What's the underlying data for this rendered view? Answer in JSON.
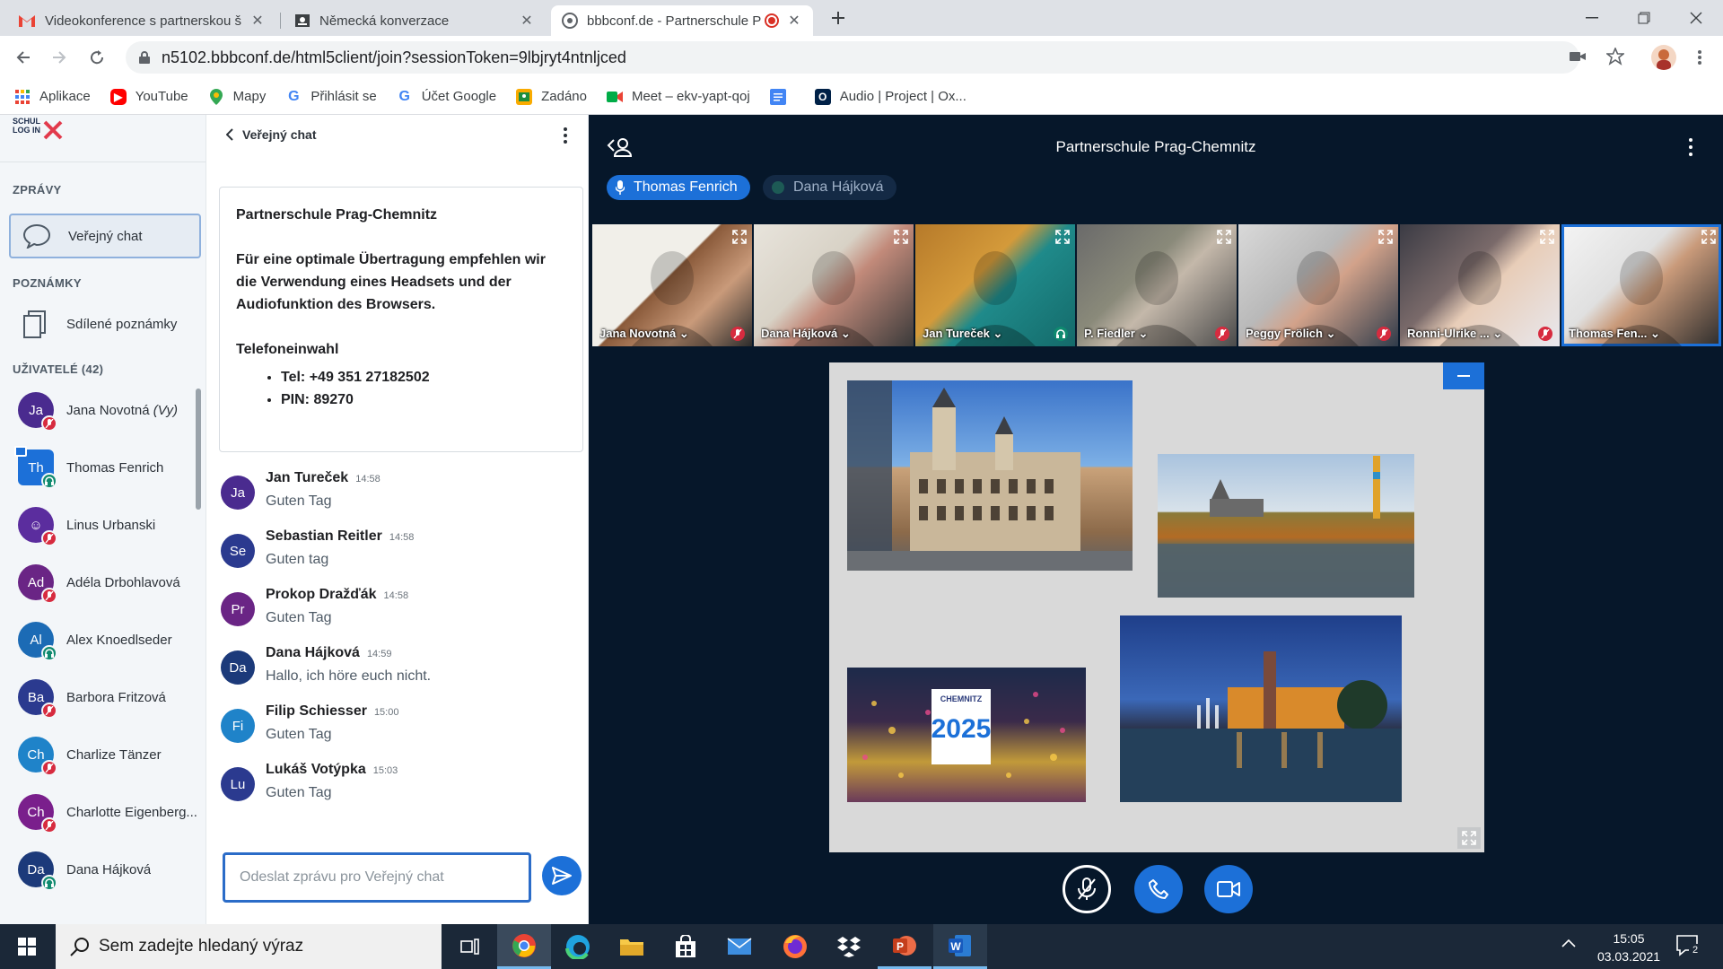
{
  "browser": {
    "tabs": [
      {
        "title": "Videokonference s partnerskou š",
        "favicon": "gmail-icon"
      },
      {
        "title": "Německá konverzace",
        "favicon": "classroom-icon"
      },
      {
        "title": "bbbconf.de - Partnerschule P",
        "favicon": "bbb-icon"
      }
    ],
    "url": "n5102.bbbconf.de/html5client/join?sessionToken=9lbjryt4ntnljced",
    "bookmarks": [
      "Aplikace",
      "YouTube",
      "Mapy",
      "Přihlásit se",
      "Účet Google",
      "Zadáno",
      "Meet – ekv-yapt-qoj",
      "",
      "Audio | Project | Ox..."
    ]
  },
  "sidebar": {
    "logo": "SCHUL LOG IN",
    "messages_title": "ZPRÁVY",
    "public_chat": "Veřejný chat",
    "notes_title": "POZNÁMKY",
    "shared_notes": "Sdílené poznámky",
    "users_title": "UŽIVATELÉ (42)",
    "users": [
      {
        "initials": "Ja",
        "name": "Jana Novotná",
        "suffix": "(Vy)",
        "color": "#4a2b8f",
        "status": "muted"
      },
      {
        "initials": "Th",
        "name": "Thomas Fenrich",
        "suffix": "",
        "color": "#1c70d8",
        "status": "listen",
        "presenter": true
      },
      {
        "initials": "☺",
        "name": "Linus Urbanski",
        "suffix": "",
        "color": "#5b2d9e",
        "status": "muted"
      },
      {
        "initials": "Ad",
        "name": "Adéla Drbohlavová",
        "suffix": "",
        "color": "#6a2585",
        "status": "muted"
      },
      {
        "initials": "Al",
        "name": "Alex Knoedlseder",
        "suffix": "",
        "color": "#1c6bb5",
        "status": "listen"
      },
      {
        "initials": "Ba",
        "name": "Barbora Fritzová",
        "suffix": "",
        "color": "#2b3a8f",
        "status": "muted"
      },
      {
        "initials": "Ch",
        "name": "Charlize Tänzer",
        "suffix": "",
        "color": "#1f83c9",
        "status": "muted"
      },
      {
        "initials": "Ch",
        "name": "Charlotte Eigenberg...",
        "suffix": "",
        "color": "#7a1f8c",
        "status": "muted"
      },
      {
        "initials": "Da",
        "name": "Dana Hájková",
        "suffix": "",
        "color": "#1c3a7a",
        "status": "listen"
      }
    ]
  },
  "chat": {
    "header": "Veřejný chat",
    "welcome": {
      "title": "Partnerschule Prag-Chemnitz",
      "body": "Für eine optimale Übertragung empfehlen wir die Verwendung eines Headsets und der Audiofunktion des Browsers.",
      "phone_title": "Telefoneinwahl",
      "tel": "Tel: +49 351 27182502",
      "pin": "PIN: 89270"
    },
    "messages": [
      {
        "initials": "Ja",
        "name": "Jan Tureček",
        "time": "14:58",
        "text": "Guten Tag",
        "color": "#4a2b8f"
      },
      {
        "initials": "Se",
        "name": "Sebastian Reitler",
        "time": "14:58",
        "text": "Guten tag",
        "color": "#2b3a8f"
      },
      {
        "initials": "Pr",
        "name": "Prokop Dražďák",
        "time": "14:58",
        "text": "Guten Tag",
        "color": "#6a2585"
      },
      {
        "initials": "Da",
        "name": "Dana Hájková",
        "time": "14:59",
        "text": "Hallo, ich höre euch nicht.",
        "color": "#1c3a7a"
      },
      {
        "initials": "Fi",
        "name": "Filip Schiesser",
        "time": "15:00",
        "text": "Guten Tag",
        "color": "#1f83c9"
      },
      {
        "initials": "Lu",
        "name": "Lukáš Votýpka",
        "time": "15:03",
        "text": "Guten Tag",
        "color": "#2b3a8f"
      }
    ],
    "input_placeholder": "Odeslat zprávu pro Veřejný chat"
  },
  "main": {
    "meeting_title": "Partnerschule Prag-Chemnitz",
    "talkers": [
      "Thomas Fenrich",
      "Dana Hájková"
    ],
    "videos": [
      {
        "name": "Jana Novotná",
        "status": "muted"
      },
      {
        "name": "Dana Hájková",
        "status": "none"
      },
      {
        "name": "Jan Tureček",
        "status": "listen"
      },
      {
        "name": "P. Fiedler",
        "status": "muted"
      },
      {
        "name": "Peggy Frölich",
        "status": "muted"
      },
      {
        "name": "Ronni-Ulrike ...",
        "status": "muted"
      },
      {
        "name": "Thomas Fen...",
        "status": "none"
      }
    ],
    "slide_badge": "CHEMNITZ"
  },
  "taskbar": {
    "search_placeholder": "Sem zadejte hledaný výraz",
    "time": "15:05",
    "date": "03.03.2021",
    "notifications": "2"
  },
  "colors": {
    "accent": "#1c70d8",
    "muted": "#d72b3f",
    "listen": "#0f8a6f",
    "dark_bg": "#06172a"
  }
}
